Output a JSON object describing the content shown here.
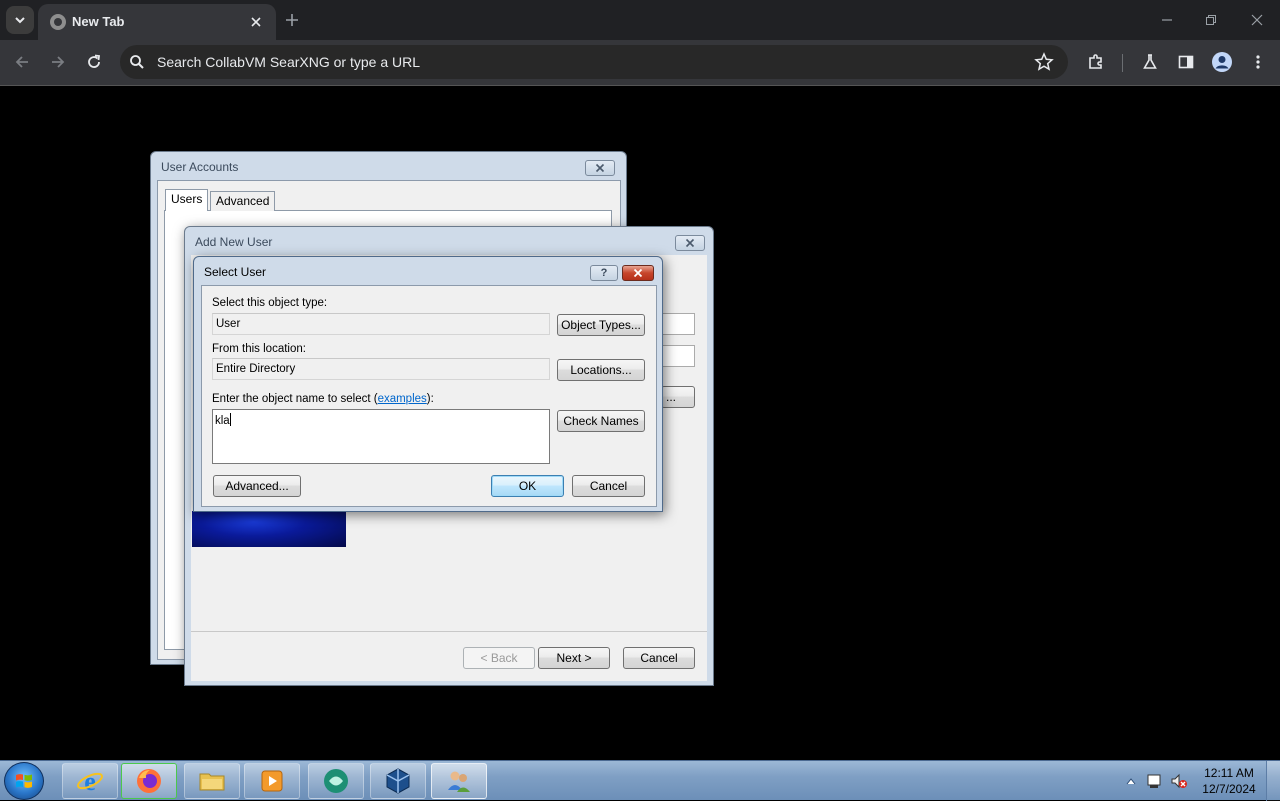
{
  "browser": {
    "tab_title": "New Tab",
    "omnibox_placeholder": "Search CollabVM SearXNG or type a URL"
  },
  "user_accounts": {
    "title": "User Accounts",
    "tabs": [
      "Users",
      "Advanced"
    ]
  },
  "add_new_user": {
    "title": "Add New User",
    "back_label": "< Back",
    "next_label": "Next >",
    "cancel_label": "Cancel",
    "partial_button_label": "..."
  },
  "select_user": {
    "title": "Select User",
    "help_label": "?",
    "object_type_label": "Select this object type:",
    "object_type_value": "User",
    "object_types_button": "Object Types...",
    "location_label": "From this location:",
    "location_value": "Entire Directory",
    "locations_button": "Locations...",
    "enter_name_prefix": "Enter the object name to select (",
    "examples_link": "examples",
    "enter_name_suffix": "):",
    "name_input_value": "kla",
    "check_names_button": "Check Names",
    "advanced_button": "Advanced...",
    "ok_button": "OK",
    "cancel_button": "Cancel"
  },
  "taskbar": {
    "apps": [
      "internet-explorer",
      "firefox",
      "file-explorer",
      "media-player",
      "collabvm",
      "virtualbox",
      "users"
    ],
    "clock_time": "12:11 AM",
    "clock_date": "12/7/2024"
  }
}
